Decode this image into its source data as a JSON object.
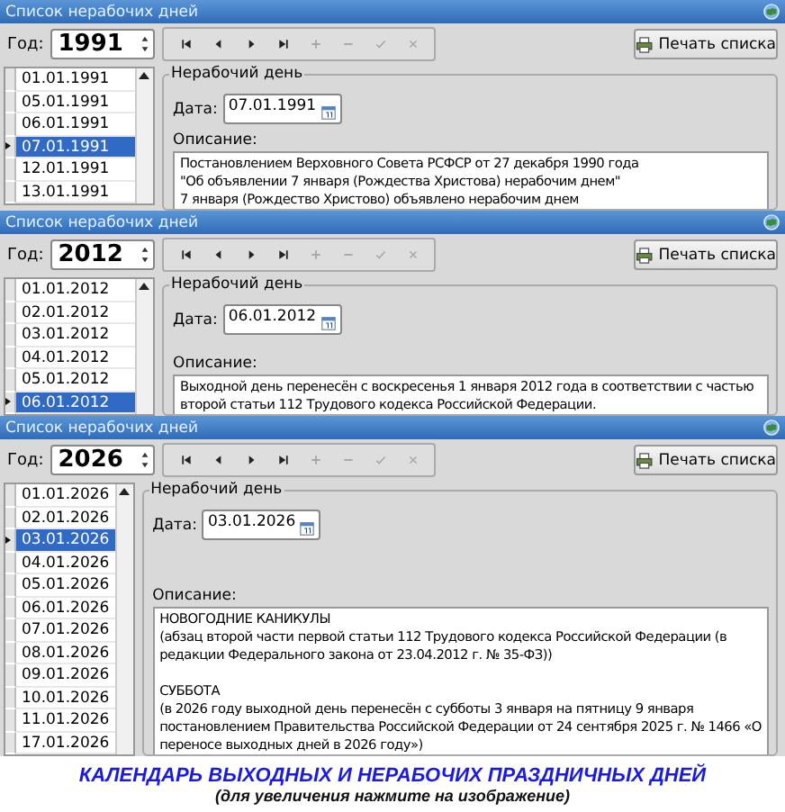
{
  "panels": [
    {
      "title": "Список нерабочих дней",
      "year_label": "Год:",
      "year": "1991",
      "print_button": "Печать списка",
      "dates": [
        {
          "date": "01.01.1991",
          "selected": false
        },
        {
          "date": "05.01.1991",
          "selected": false
        },
        {
          "date": "06.01.1991",
          "selected": false
        },
        {
          "date": "07.01.1991",
          "selected": true
        },
        {
          "date": "12.01.1991",
          "selected": false
        },
        {
          "date": "13.01.1991",
          "selected": false
        }
      ],
      "group_title": "Нерабочий день",
      "date_label": "Дата:",
      "date_value": "07.01.1991",
      "description_label": "Описание:",
      "description": [
        [
          "Постановлением Верховного Совета РСФСР от 27 декабря 1990 года",
          "\"Об объявлении 7 января (Рождества Христова) нерабочим днем\"",
          "7 января (Рождество Христово) объявлено нерабочим днем"
        ]
      ]
    },
    {
      "title": "Список нерабочих дней",
      "year_label": "Год:",
      "year": "2012",
      "print_button": "Печать списка",
      "dates": [
        {
          "date": "01.01.2012",
          "selected": false
        },
        {
          "date": "02.01.2012",
          "selected": false
        },
        {
          "date": "03.01.2012",
          "selected": false
        },
        {
          "date": "04.01.2012",
          "selected": false
        },
        {
          "date": "05.01.2012",
          "selected": false
        },
        {
          "date": "06.01.2012",
          "selected": true
        }
      ],
      "group_title": "Нерабочий день",
      "date_label": "Дата:",
      "date_value": "06.01.2012",
      "description_label": "Описание:",
      "description": [
        [
          "Выходной день перенесён с воскресенья 1 января 2012 года в соответствии с частью",
          "второй статьи 112 Трудового кодекса Российской Федерации."
        ]
      ]
    },
    {
      "title": "Список нерабочих дней",
      "year_label": "Год:",
      "year": "2026",
      "print_button": "Печать списка",
      "dates": [
        {
          "date": "01.01.2026",
          "selected": false
        },
        {
          "date": "02.01.2026",
          "selected": false
        },
        {
          "date": "03.01.2026",
          "selected": true
        },
        {
          "date": "04.01.2026",
          "selected": false
        },
        {
          "date": "05.01.2026",
          "selected": false
        },
        {
          "date": "06.01.2026",
          "selected": false
        },
        {
          "date": "07.01.2026",
          "selected": false
        },
        {
          "date": "08.01.2026",
          "selected": false
        },
        {
          "date": "09.01.2026",
          "selected": false
        },
        {
          "date": "10.01.2026",
          "selected": false
        },
        {
          "date": "11.01.2026",
          "selected": false
        },
        {
          "date": "17.01.2026",
          "selected": false
        }
      ],
      "group_title": "Нерабочий день",
      "date_label": "Дата:",
      "date_value": "03.01.2026",
      "description_label": "Описание:",
      "description": [
        [
          "НОВОГОДНИЕ КАНИКУЛЫ",
          "(абзац второй части первой статьи 112 Трудового кодекса Российской Федерации (в",
          "редакции Федерального закона от 23.04.2012 г. № 35-ФЗ))"
        ],
        [
          "СУББОТА",
          "(в 2026 году выходной день перенесён с субботы 3 января на пятницу 9 января",
          "постановлением Правительства Российской Федерации от 24 сентября 2025 г. № 1466 «О",
          "переносе выходных дней в 2026 году»)"
        ]
      ]
    }
  ],
  "nav_buttons": [
    {
      "kind": "first",
      "disabled": false
    },
    {
      "kind": "prev",
      "disabled": false
    },
    {
      "kind": "next",
      "disabled": false
    },
    {
      "kind": "last",
      "disabled": false
    },
    {
      "kind": "add",
      "disabled": true
    },
    {
      "kind": "remove",
      "disabled": true
    },
    {
      "kind": "confirm",
      "disabled": true
    },
    {
      "kind": "cancel",
      "disabled": true
    }
  ],
  "caption": {
    "title": "КАЛЕНДАРЬ ВЫХОДНЫХ И НЕРАБОЧИХ ПРАЗДНИЧНЫХ ДНЕЙ",
    "subtitle": "(для увеличения нажмите на изображение)"
  }
}
